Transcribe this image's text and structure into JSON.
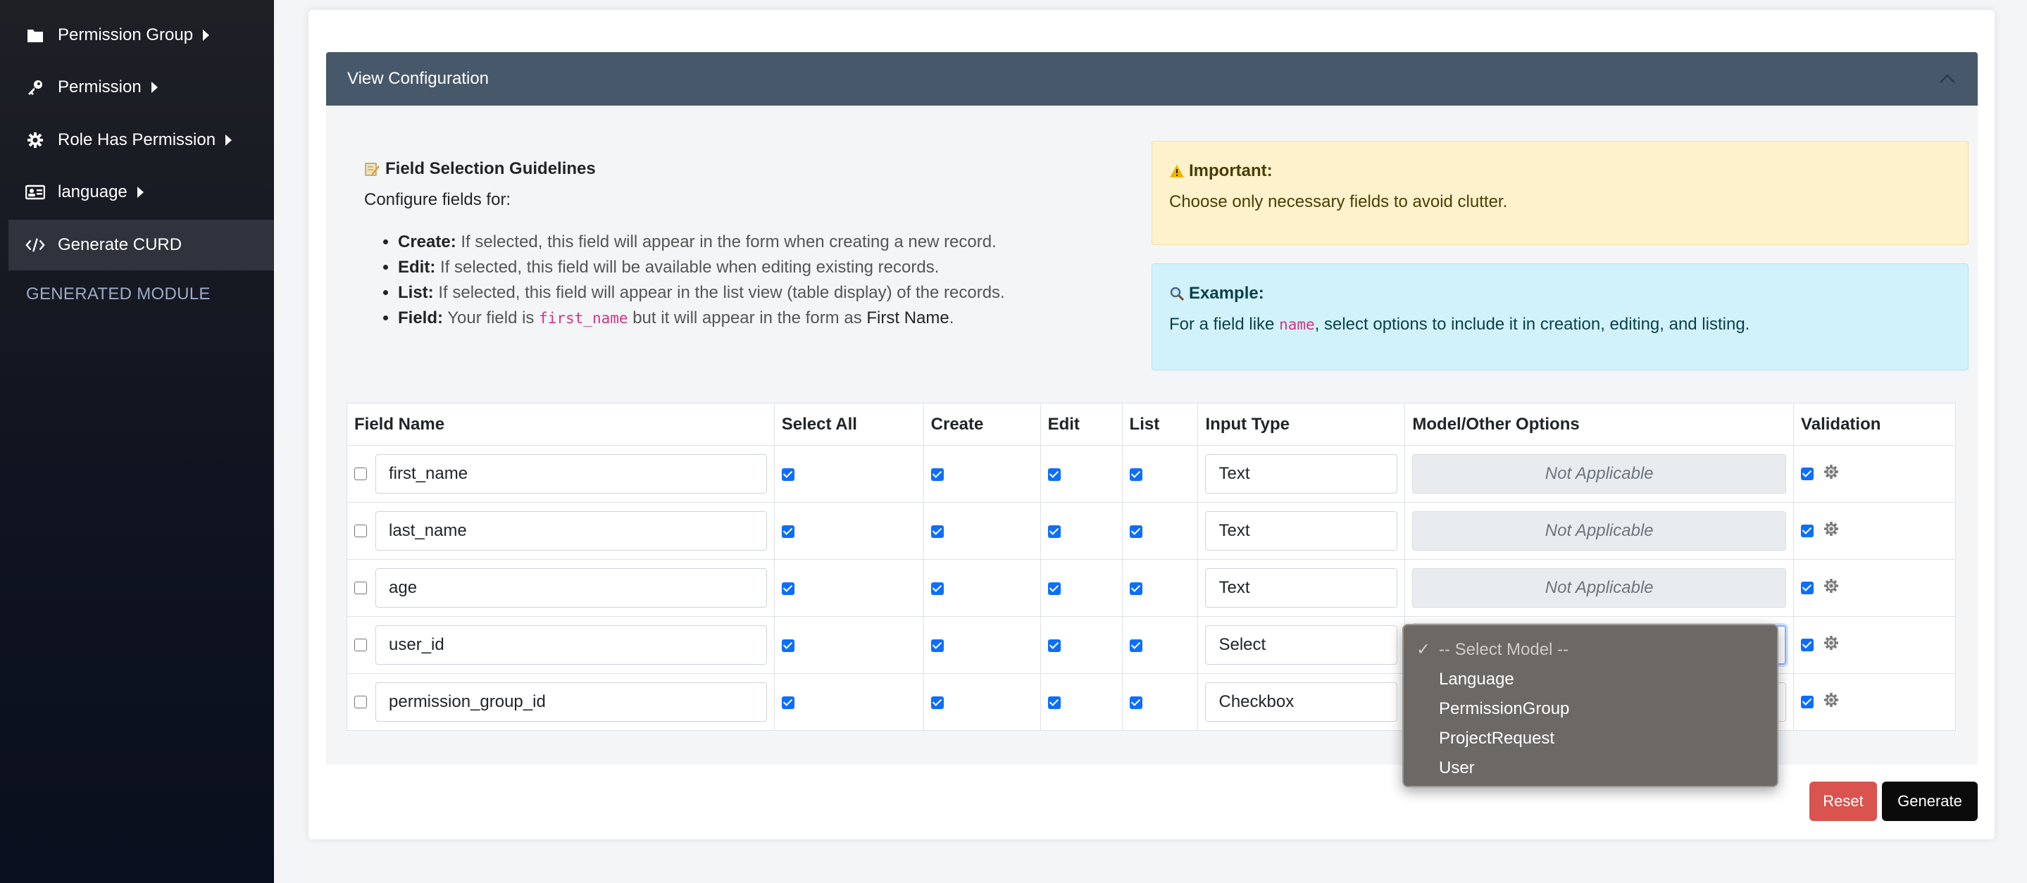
{
  "sidebar": {
    "items": [
      {
        "label": "Permission Group",
        "icon": "folder-icon"
      },
      {
        "label": "Permission",
        "icon": "key-icon"
      },
      {
        "label": "Role Has Permission",
        "icon": "gear-icon"
      },
      {
        "label": "language",
        "icon": "id-card-icon"
      },
      {
        "label": "Generate CURD",
        "icon": "code-icon"
      }
    ],
    "section_heading": "GENERATED MODULE"
  },
  "panel": {
    "title": "View Configuration"
  },
  "guidelines": {
    "title": "Field Selection Guidelines",
    "intro": "Configure fields for:",
    "items": [
      {
        "term": "Create:",
        "text": "If selected, this field will appear in the form when creating a new record."
      },
      {
        "term": "Edit:",
        "text": "If selected, this field will be available when editing existing records."
      },
      {
        "term": "List:",
        "text": "If selected, this field will appear in the list view (table display) of the records."
      },
      {
        "term": "Field:",
        "text_before": "Your field is",
        "code": "first_name",
        "text_middle": "but it will appear in the form as",
        "bold": "First Name",
        "text_after": "."
      }
    ]
  },
  "alerts": {
    "important": {
      "title": "Important:",
      "text": "Choose only necessary fields to avoid clutter."
    },
    "example": {
      "title": "Example:",
      "text_before": "For a field like",
      "code": "name",
      "text_after": ", select options to include it in creation, editing, and listing."
    }
  },
  "table": {
    "headers": [
      "Field Name",
      "Select All",
      "Create",
      "Edit",
      "List",
      "Input Type",
      "Model/Other Options",
      "Validation"
    ],
    "rows": [
      {
        "field": "first_name",
        "input_type": "Text",
        "model": "Not Applicable"
      },
      {
        "field": "last_name",
        "input_type": "Text",
        "model": "Not Applicable"
      },
      {
        "field": "age",
        "input_type": "Text",
        "model": "Not Applicable"
      },
      {
        "field": "user_id",
        "input_type": "Select",
        "model": ""
      },
      {
        "field": "permission_group_id",
        "input_type": "Checkbox",
        "model": ""
      }
    ]
  },
  "model_dropdown": {
    "options": [
      "-- Select Model --",
      "Language",
      "PermissionGroup",
      "ProjectRequest",
      "User"
    ],
    "selected": "-- Select Model --"
  },
  "actions": {
    "reset": "Reset",
    "generate": "Generate"
  },
  "colors": {
    "accent": "#0d6efd",
    "panel_header": "#48586b",
    "reset": "#d9534f",
    "generate": "#0b0b0b"
  }
}
